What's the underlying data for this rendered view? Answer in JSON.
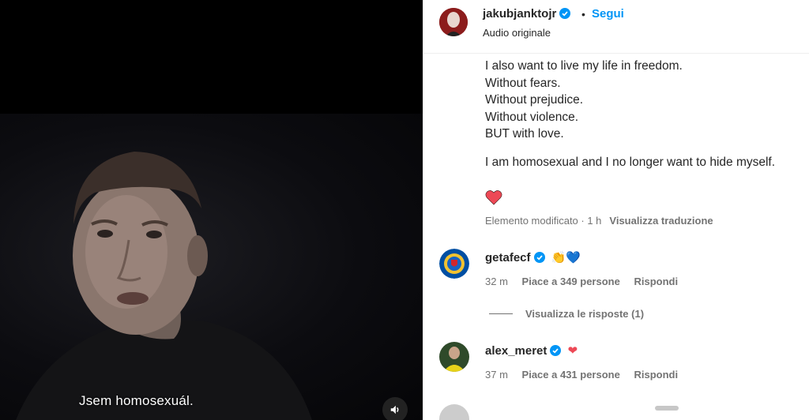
{
  "video": {
    "subtitle": "Jsem homosexuál."
  },
  "post": {
    "username": "jakubjanktojr",
    "dot": "•",
    "follow_label": "Segui",
    "audio_label": "Audio originale",
    "caption_lines_1": [
      "I also want to live my life in freedom.",
      "Without fears.",
      "Without prejudice.",
      "Without violence.",
      "BUT with love."
    ],
    "caption_line_2": "I am homosexual and I no longer want to hide myself.",
    "meta_status": "Elemento modificato · 1 h",
    "meta_translate": "Visualizza traduzione"
  },
  "comments": [
    {
      "username": "getafecf",
      "emoji": "👏💙",
      "time": "32 m",
      "likes": "Piace a 349 persone",
      "reply": "Rispondi"
    },
    {
      "username": "alex_meret",
      "emoji": "❤",
      "time": "37 m",
      "likes": "Piace a 431 persone",
      "reply": "Rispondi"
    }
  ],
  "view_replies": "Visualizza le risposte (1)",
  "colors": {
    "accent": "#0095f6",
    "heart": "#ed4956",
    "text": "#262626",
    "muted": "#737373"
  }
}
